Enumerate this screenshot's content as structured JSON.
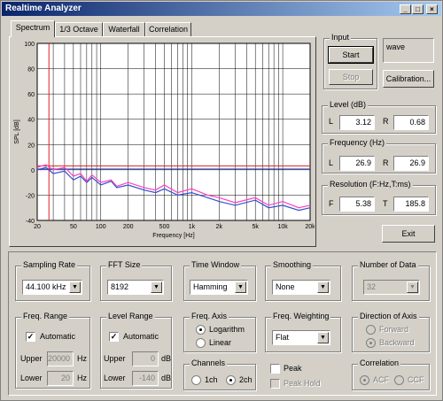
{
  "window": {
    "title": "Realtime Analyzer"
  },
  "titlebar_buttons": [
    "_",
    "□",
    "×"
  ],
  "tabs": [
    "Spectrum",
    "1/3 Octave",
    "Waterfall",
    "Correlation"
  ],
  "input": {
    "label": "Input",
    "start": "Start",
    "stop": "Stop",
    "source": "wave",
    "calibration": "Calibration..."
  },
  "level": {
    "label": "Level (dB)",
    "l_label": "L",
    "l_value": "3.12",
    "r_label": "R",
    "r_value": "0.68"
  },
  "frequency": {
    "label": "Frequency (Hz)",
    "l_label": "L",
    "l_value": "26.9",
    "r_label": "R",
    "r_value": "26.9"
  },
  "resolution": {
    "label": "Resolution (F:Hz,T:ms)",
    "f_label": "F",
    "f_value": "5.38",
    "t_label": "T",
    "t_value": "185.8"
  },
  "exit": "Exit",
  "chart_data": {
    "type": "line",
    "xlabel": "Frequency  [Hz]",
    "ylabel": "SPL  [dB]",
    "xscale": "log",
    "xlim": [
      20,
      20000
    ],
    "ylim": [
      -40,
      100
    ],
    "x_ticks": [
      "20",
      "50",
      "100",
      "200",
      "500",
      "1k",
      "2k",
      "5k",
      "10k",
      "20k"
    ],
    "y_ticks": [
      "100",
      "80",
      "60",
      "40",
      "20",
      "0",
      "-20",
      "-40"
    ],
    "grid": true,
    "series": [
      {
        "color": "#3050d0",
        "x": [
          20,
          25,
          30,
          40,
          50,
          60,
          70,
          80,
          100,
          130,
          150,
          200,
          300,
          400,
          500,
          700,
          1000,
          1500,
          2000,
          3000,
          5000,
          7000,
          10000,
          15000,
          20000
        ],
        "values": [
          0,
          2,
          -3,
          -1,
          -8,
          -5,
          -10,
          -6,
          -12,
          -9,
          -14,
          -12,
          -16,
          -18,
          -15,
          -20,
          -18,
          -22,
          -25,
          -28,
          -24,
          -30,
          -28,
          -32,
          -30
        ]
      },
      {
        "color": "#ff40c0",
        "x": [
          20,
          25,
          30,
          40,
          50,
          60,
          70,
          80,
          100,
          130,
          150,
          200,
          300,
          400,
          500,
          700,
          1000,
          1500,
          2000,
          3000,
          5000,
          7000,
          10000,
          15000,
          20000
        ],
        "values": [
          2,
          4,
          0,
          2,
          -5,
          -3,
          -9,
          -4,
          -10,
          -8,
          -13,
          -10,
          -14,
          -16,
          -12,
          -18,
          -15,
          -20,
          -22,
          -26,
          -22,
          -28,
          -25,
          -30,
          -28
        ]
      }
    ],
    "reference_lines": [
      {
        "color": "#e02020",
        "y": 3.12
      },
      {
        "color": "#3050d0",
        "y": 0.68
      },
      {
        "color": "#e02020",
        "x": 26.9
      }
    ]
  },
  "sampling_rate": {
    "label": "Sampling Rate",
    "value": "44.100 kHz"
  },
  "fft_size": {
    "label": "FFT Size",
    "value": "8192"
  },
  "time_window": {
    "label": "Time Window",
    "value": "Hamming"
  },
  "smoothing": {
    "label": "Smoothing",
    "value": "None"
  },
  "number_of_data": {
    "label": "Number of Data",
    "value": "32"
  },
  "freq_range": {
    "label": "Freq. Range",
    "automatic": "Automatic",
    "upper_label": "Upper",
    "upper_value": "20000",
    "upper_unit": "Hz",
    "lower_label": "Lower",
    "lower_value": "20",
    "lower_unit": "Hz"
  },
  "level_range": {
    "label": "Level Range",
    "automatic": "Automatic",
    "upper_label": "Upper",
    "upper_value": "0",
    "upper_unit": "dB",
    "lower_label": "Lower",
    "lower_value": "-140",
    "lower_unit": "dB"
  },
  "freq_axis": {
    "label": "Freq. Axis",
    "logarithm": "Logarithm",
    "linear": "Linear"
  },
  "freq_weighting": {
    "label": "Freq. Weighting",
    "value": "Flat"
  },
  "direction_of_axis": {
    "label": "Direction of Axis",
    "forward": "Forward",
    "backward": "Backward"
  },
  "channels": {
    "label": "Channels",
    "one": "1ch",
    "two": "2ch"
  },
  "peak": {
    "peak": "Peak",
    "peak_hold": "Peak Hold"
  },
  "correlation": {
    "label": "Correlation",
    "acf": "ACF",
    "ccf": "CCF"
  }
}
